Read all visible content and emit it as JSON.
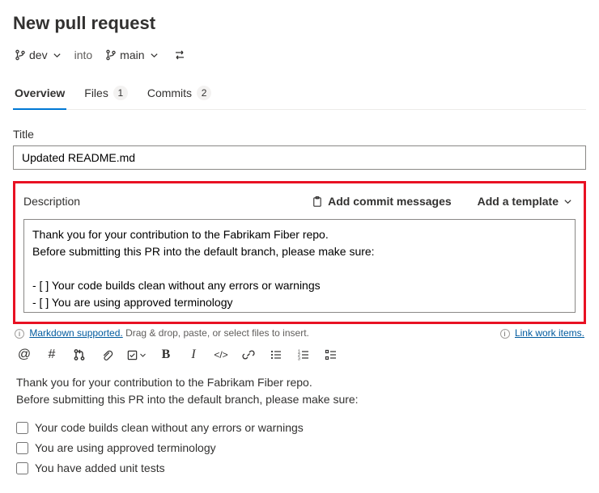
{
  "header": {
    "title": "New pull request"
  },
  "branch": {
    "source": "dev",
    "into_label": "into",
    "target": "main"
  },
  "tabs": {
    "overview": {
      "label": "Overview"
    },
    "files": {
      "label": "Files",
      "count": "1"
    },
    "commits": {
      "label": "Commits",
      "count": "2"
    }
  },
  "form": {
    "title_label": "Title",
    "title_value": "Updated README.md",
    "description_label": "Description",
    "add_commit_messages": "Add commit messages",
    "add_template": "Add a template",
    "description_value": "Thank you for your contribution to the Fabrikam Fiber repo.\nBefore submitting this PR into the default branch, please make sure:\n\n- [ ] Your code builds clean without any errors or warnings\n- [ ] You are using approved terminology\n- [ ] You have added unit tests"
  },
  "hints": {
    "markdown_supported": "Markdown supported.",
    "drag_drop": "Drag & drop, paste, or select files to insert.",
    "link_work_items": "Link work items."
  },
  "preview": {
    "intro": "Thank you for your contribution to the Fabrikam Fiber repo.\nBefore submitting this PR into the default branch, please make sure:",
    "items": [
      "Your code builds clean without any errors or warnings",
      "You are using approved terminology",
      "You have added unit tests"
    ]
  }
}
